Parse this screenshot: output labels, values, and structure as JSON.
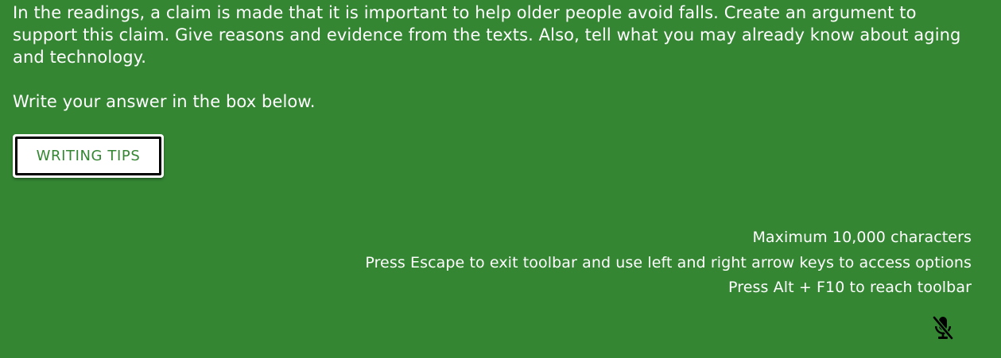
{
  "prompt": {
    "text": "In the readings, a claim is made that it is important to help older people avoid falls. Create an argument to support this claim. Give reasons and evidence from the texts. Also, tell what you may already know about aging and technology.",
    "instruction": "Write your answer in the box below."
  },
  "writing_tips": {
    "label": "WRITING TIPS"
  },
  "editor_hints": {
    "max_chars": "Maximum 10,000 characters",
    "escape_hint": "Press Escape to exit toolbar and use left and right arrow keys to access options",
    "toolbar_hint": "Press Alt + F10 to reach toolbar"
  },
  "icons": {
    "mic": "microphone-off-icon"
  },
  "colors": {
    "background": "#348633",
    "button_text": "#348633",
    "text": "#ffffff"
  }
}
